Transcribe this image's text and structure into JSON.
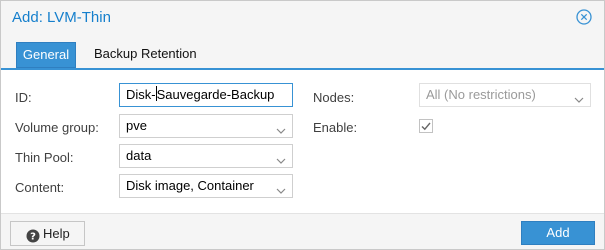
{
  "dialog": {
    "title": "Add: LVM-Thin"
  },
  "tabs": [
    {
      "label": "General",
      "active": true
    },
    {
      "label": "Backup Retention",
      "active": false
    }
  ],
  "form": {
    "id_label": "ID:",
    "id_value_before_cursor": "Disk-",
    "id_value_after_cursor": "Sauvegarde-Backup",
    "volume_group_label": "Volume group:",
    "volume_group_value": "pve",
    "thin_pool_label": "Thin Pool:",
    "thin_pool_value": "data",
    "content_label": "Content:",
    "content_value": "Disk image, Container",
    "nodes_label": "Nodes:",
    "nodes_value": "All (No restrictions)",
    "enable_label": "Enable:",
    "enable_checked": true
  },
  "footer": {
    "help_label": "Help",
    "add_label": "Add"
  },
  "colors": {
    "accent": "#3892d4",
    "title": "#157fcc"
  },
  "icons": {
    "close": "close-icon",
    "help": "question-circle-icon",
    "dropdown": "chevron-down-icon",
    "check": "checkmark-icon"
  }
}
